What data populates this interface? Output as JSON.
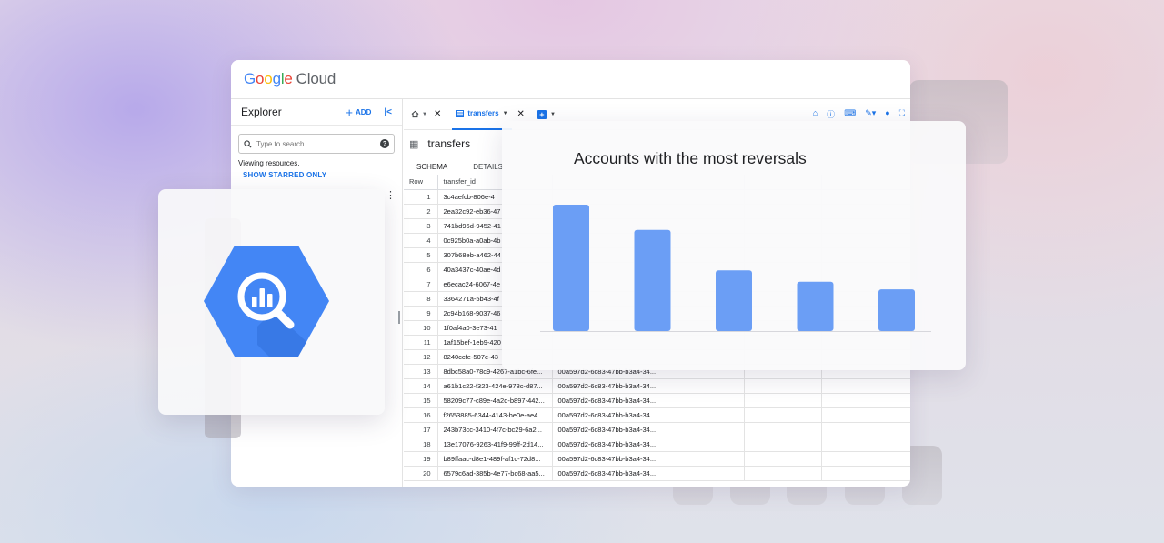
{
  "app": {
    "logo_google": "Google",
    "logo_cloud": "Cloud"
  },
  "explorer": {
    "title": "Explorer",
    "add_label": "ADD",
    "search_placeholder": "Type to search",
    "viewing_text": "Viewing resources.",
    "show_starred": "SHOW STARRED ONLY"
  },
  "tabs": {
    "active_label": "transfers"
  },
  "table": {
    "name": "transfers",
    "subtabs": [
      "SCHEMA",
      "DETAILS"
    ],
    "columns": [
      "Row",
      "transfer_id"
    ],
    "rows": [
      {
        "row": "1",
        "transfer_id": "3c4aefcb-806e-4"
      },
      {
        "row": "2",
        "transfer_id": "2ea32c92-eb36-47"
      },
      {
        "row": "3",
        "transfer_id": "741bd96d-9452-41"
      },
      {
        "row": "4",
        "transfer_id": "0c925b0a-a0ab-4b"
      },
      {
        "row": "5",
        "transfer_id": "307b68eb-a462-44"
      },
      {
        "row": "6",
        "transfer_id": "40a3437c-40ae-4d"
      },
      {
        "row": "7",
        "transfer_id": "e6ecac24-6067-4e"
      },
      {
        "row": "8",
        "transfer_id": "3364271a-5b43-4f"
      },
      {
        "row": "9",
        "transfer_id": "2c94b168-9037-46"
      },
      {
        "row": "10",
        "transfer_id": "1f0af4a0-3e73-41"
      },
      {
        "row": "11",
        "transfer_id": "1af15bef-1eb9-420"
      },
      {
        "row": "12",
        "transfer_id": "8240ccfe-507e-43"
      },
      {
        "row": "13",
        "transfer_id": "8dbc58a0-78c9-4267-a1bc-6fe...",
        "account": "00a597d2-6c83-47bb-b3a4-34..."
      },
      {
        "row": "14",
        "transfer_id": "a61b1c22-f323-424e-978c-d87...",
        "account": "00a597d2-6c83-47bb-b3a4-34..."
      },
      {
        "row": "15",
        "transfer_id": "58209c77-c89e-4a2d-b897-442...",
        "account": "00a597d2-6c83-47bb-b3a4-34..."
      },
      {
        "row": "16",
        "transfer_id": "f2653885-6344-4143-be0e-ae4...",
        "account": "00a597d2-6c83-47bb-b3a4-34..."
      },
      {
        "row": "17",
        "transfer_id": "243b73cc-3410-4f7c-bc29-6a2...",
        "account": "00a597d2-6c83-47bb-b3a4-34..."
      },
      {
        "row": "18",
        "transfer_id": "13e17076-9263-41f9-99ff-2d14...",
        "account": "00a597d2-6c83-47bb-b3a4-34..."
      },
      {
        "row": "19",
        "transfer_id": "b89ffaac-d8e1-489f-af1c-72d8...",
        "account": "00a597d2-6c83-47bb-b3a4-34..."
      },
      {
        "row": "20",
        "transfer_id": "6579c6ad-385b-4e77-bc68-aa5...",
        "account": "00a597d2-6c83-47bb-b3a4-34..."
      }
    ]
  },
  "chart_data": {
    "type": "bar",
    "title": "Accounts with the most reversals",
    "categories": [],
    "values": [
      100,
      80,
      48,
      39,
      33
    ],
    "xlabel": "",
    "ylabel": "",
    "ylim": [
      0,
      100
    ],
    "grid": false,
    "bar_color": "#6b9ef5"
  },
  "colors": {
    "accent": "#1a73e8",
    "bigquery_blue": "#4386f5"
  }
}
